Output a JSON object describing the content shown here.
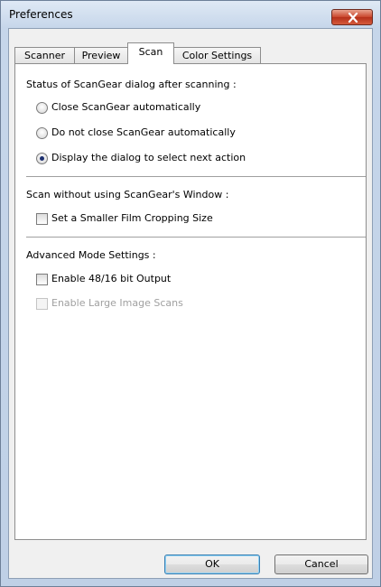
{
  "window": {
    "title": "Preferences"
  },
  "tabs": [
    {
      "label": "Scanner"
    },
    {
      "label": "Preview"
    },
    {
      "label": "Scan"
    },
    {
      "label": "Color Settings"
    }
  ],
  "status_section": {
    "heading": "Status of ScanGear dialog after scanning :",
    "options": [
      {
        "label": "Close ScanGear automatically",
        "selected": false
      },
      {
        "label": "Do not close ScanGear automatically",
        "selected": false
      },
      {
        "label": "Display the dialog to select next action",
        "selected": true
      }
    ]
  },
  "scan_without_section": {
    "heading": "Scan without using ScanGear's Window :",
    "smaller_film_label": "Set a Smaller Film Cropping Size",
    "smaller_film_checked": false
  },
  "advanced_section": {
    "heading": "Advanced Mode Settings :",
    "enable_48_16_label": "Enable 48/16 bit Output",
    "enable_48_16_checked": false,
    "enable_large_label": "Enable Large Image Scans",
    "enable_large_checked": false,
    "enable_large_disabled": true
  },
  "buttons": {
    "ok_label": "OK",
    "cancel_label": "Cancel"
  },
  "colors": {
    "close_button": "#c9452c",
    "title_bar": "#c6d6ea",
    "disabled_text": "#a0a0a0"
  }
}
